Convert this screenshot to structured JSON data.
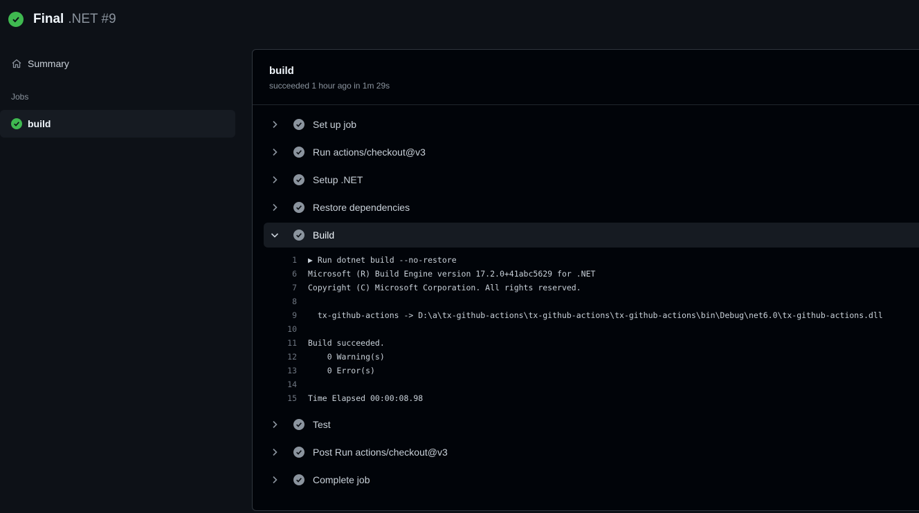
{
  "header": {
    "title": "Final",
    "subtitle": ".NET #9",
    "status_icon": "check-circle-icon",
    "status_color": "#3fb950"
  },
  "sidebar": {
    "summary_label": "Summary",
    "summary_icon": "home-icon",
    "jobs_heading": "Jobs",
    "job_label": "build"
  },
  "job": {
    "title": "build",
    "meta": "succeeded 1 hour ago in 1m 29s"
  },
  "steps": {
    "s1": "Set up job",
    "s2": "Run actions/checkout@v3",
    "s3": "Setup .NET",
    "s4": "Restore dependencies",
    "s5": "Build",
    "s6": "Test",
    "s7": "Post Run actions/checkout@v3",
    "s8": "Complete job"
  },
  "log": [
    {
      "n": "1",
      "t": "▶ Run dotnet build --no-restore"
    },
    {
      "n": "6",
      "t": "Microsoft (R) Build Engine version 17.2.0+41abc5629 for .NET"
    },
    {
      "n": "7",
      "t": "Copyright (C) Microsoft Corporation. All rights reserved."
    },
    {
      "n": "8",
      "t": ""
    },
    {
      "n": "9",
      "t": "  tx-github-actions -> D:\\a\\tx-github-actions\\tx-github-actions\\tx-github-actions\\bin\\Debug\\net6.0\\tx-github-actions.dll"
    },
    {
      "n": "10",
      "t": ""
    },
    {
      "n": "11",
      "t": "Build succeeded."
    },
    {
      "n": "12",
      "t": "    0 Warning(s)"
    },
    {
      "n": "13",
      "t": "    0 Error(s)"
    },
    {
      "n": "14",
      "t": ""
    },
    {
      "n": "15",
      "t": "Time Elapsed 00:00:08.98"
    }
  ]
}
